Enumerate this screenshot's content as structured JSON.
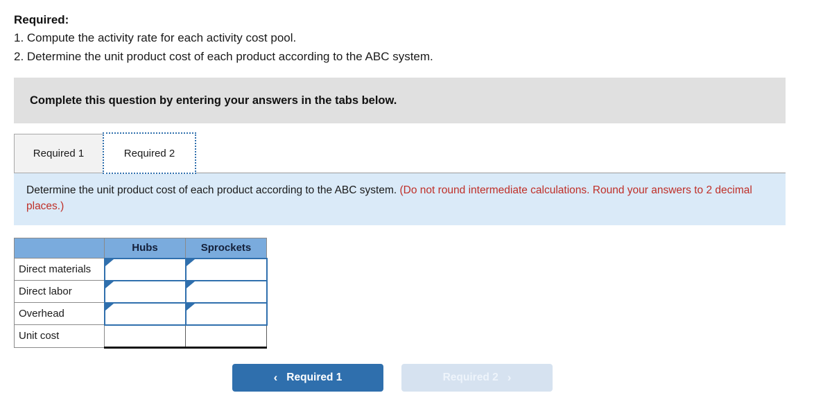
{
  "required": {
    "heading": "Required:",
    "items": [
      "1. Compute the activity rate for each activity cost pool.",
      "2. Determine the unit product cost of each product according to the ABC system."
    ]
  },
  "gray_banner": {
    "text": "Complete this question by entering your answers in the tabs below."
  },
  "tabs": [
    {
      "label": "Required 1",
      "state": "inactive"
    },
    {
      "label": "Required 2",
      "state": "active"
    }
  ],
  "info_banner": {
    "main": "Determine the unit product cost of each product according to the ABC system.",
    "note": "(Do not round intermediate calculations. Round your answers to 2 decimal places.)"
  },
  "answer_table": {
    "columns": [
      "",
      "Hubs",
      "Sprockets"
    ],
    "rows": [
      {
        "label": "Direct materials",
        "hubs": "",
        "sprockets": "",
        "type": "input"
      },
      {
        "label": "Direct labor",
        "hubs": "",
        "sprockets": "",
        "type": "input"
      },
      {
        "label": "Overhead",
        "hubs": "",
        "sprockets": "",
        "type": "input"
      },
      {
        "label": "Unit cost",
        "hubs": "",
        "sprockets": "",
        "type": "total"
      }
    ]
  },
  "nav": {
    "prev": {
      "label": "Required 1",
      "chevron": "‹",
      "state": "enabled"
    },
    "next": {
      "label": "Required 2",
      "chevron": "›",
      "state": "disabled"
    }
  },
  "colors": {
    "accent_blue": "#2f6fad",
    "header_blue": "#7aabdd",
    "info_blue": "#daeaf8",
    "gray_banner": "#e0e0e0",
    "note_red": "#bf2f28",
    "disabled_blue": "#d6e2f0"
  }
}
